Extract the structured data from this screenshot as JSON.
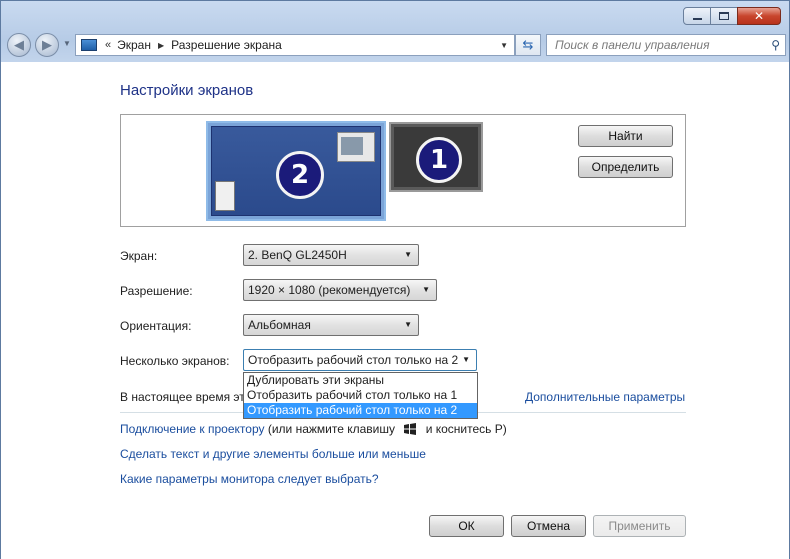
{
  "window": {
    "caption_buttons": [
      "minimize-icon",
      "maximize-icon",
      "close-icon"
    ]
  },
  "nav": {
    "breadcrumb_chevron": "«",
    "breadcrumb": [
      "Экран",
      "Разрешение экрана"
    ],
    "search_placeholder": "Поиск в панели управления"
  },
  "page": {
    "title": "Настройки экранов",
    "monitors": [
      {
        "number": "2",
        "selected": true
      },
      {
        "number": "1",
        "selected": false
      }
    ],
    "buttons": {
      "find": "Найти",
      "identify": "Определить"
    }
  },
  "fields": {
    "display_label": "Экран:",
    "display_value": "2. BenQ GL2450H",
    "resolution_label": "Разрешение:",
    "resolution_value": "1920 × 1080 (рекомендуется)",
    "orientation_label": "Ориентация:",
    "orientation_value": "Альбомная",
    "multi_label": "Несколько экранов:",
    "multi_value": "Отобразить рабочий стол только на 2",
    "multi_options": [
      "Дублировать эти экраны",
      "Отобразить рабочий стол только на 1",
      "Отобразить рабочий стол только на 2"
    ],
    "multi_selected_index": 2
  },
  "main_display_text": "В настоящее время эт",
  "advanced_link": "Дополнительные параметры",
  "projector": {
    "link": "Подключение к проектору",
    "text_before": "(или нажмите клавишу",
    "text_after": "и коснитесь P)"
  },
  "links": {
    "text_size": "Сделать текст и другие элементы больше или меньше",
    "which_monitor": "Какие параметры монитора следует выбрать?"
  },
  "footer": {
    "ok": "ОК",
    "cancel": "Отмена",
    "apply": "Применить"
  }
}
